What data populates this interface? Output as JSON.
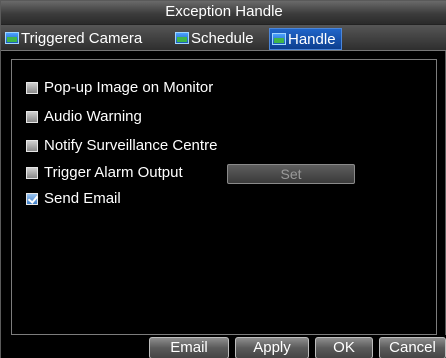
{
  "window": {
    "title": "Exception Handle"
  },
  "tabs": [
    {
      "label": "Triggered Camera",
      "icon": "camera-tab-icon",
      "active": false
    },
    {
      "label": "Schedule",
      "icon": "schedule-tab-icon",
      "active": false
    },
    {
      "label": "Handle",
      "icon": "handle-tab-icon",
      "active": true
    }
  ],
  "options": [
    {
      "label": "Pop-up Image on Monitor",
      "checked": false
    },
    {
      "label": "Audio Warning",
      "checked": false
    },
    {
      "label": "Notify Surveillance Centre",
      "checked": false
    },
    {
      "label": "Trigger Alarm Output",
      "checked": false
    },
    {
      "label": "Send Email",
      "checked": true
    }
  ],
  "set_button": {
    "label": "Set",
    "enabled": false
  },
  "buttons": {
    "email": "Email",
    "apply": "Apply",
    "ok": "OK",
    "cancel": "Cancel"
  },
  "colors": {
    "active_tab": "#1f65c9",
    "background": "#000000",
    "text": "#ffffff"
  }
}
